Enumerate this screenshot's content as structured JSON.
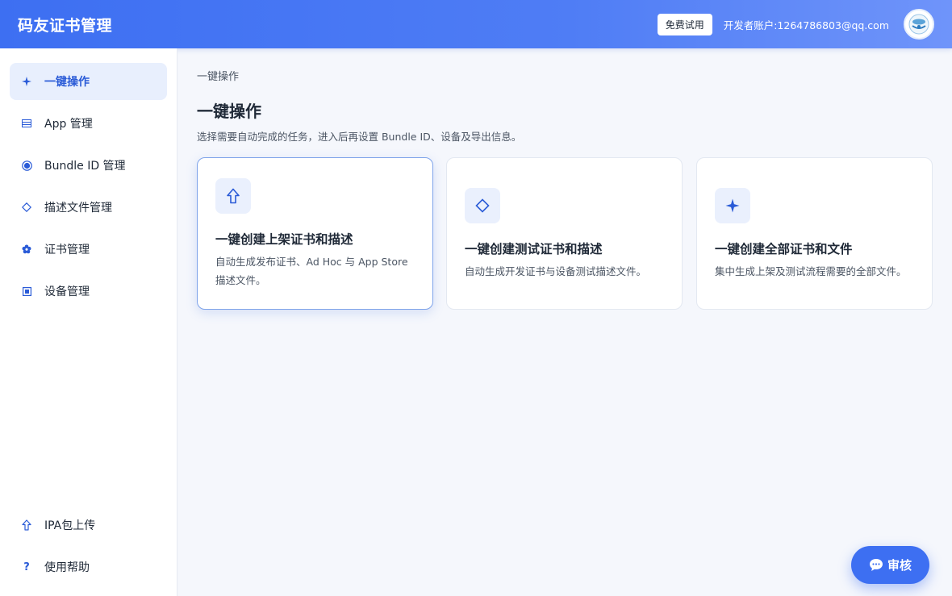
{
  "header": {
    "brand": "码友证书管理",
    "trial_label": "免费试用",
    "account": "开发者账户:1264786803@qq.com"
  },
  "sidebar": {
    "items": [
      {
        "label": "一键操作",
        "icon": "sparkle-icon",
        "active": true
      },
      {
        "label": "App 管理",
        "icon": "list-icon"
      },
      {
        "label": "Bundle ID 管理",
        "icon": "target-icon"
      },
      {
        "label": "描述文件管理",
        "icon": "diamond-icon"
      },
      {
        "label": "证书管理",
        "icon": "flower-icon"
      },
      {
        "label": "设备管理",
        "icon": "device-icon"
      }
    ],
    "bottom_items": [
      {
        "label": "IPA包上传",
        "icon": "upload-arrow-icon"
      },
      {
        "label": "使用帮助",
        "icon": "question-icon"
      }
    ]
  },
  "main": {
    "breadcrumb": "一键操作",
    "title": "一键操作",
    "description": "选择需要自动完成的任务，进入后再设置 Bundle ID、设备及导出信息。",
    "cards": [
      {
        "title": "一键创建上架证书和描述",
        "description": "自动生成发布证书、Ad Hoc 与 App Store 描述文件。",
        "icon": "upload-arrow-icon",
        "selected": true
      },
      {
        "title": "一键创建测试证书和描述",
        "description": "自动生成开发证书与设备测试描述文件。",
        "icon": "diamond-icon"
      },
      {
        "title": "一键创建全部证书和文件",
        "description": "集中生成上架及测试流程需要的全部文件。",
        "icon": "sparkle-icon"
      }
    ]
  },
  "fab": {
    "label": "审核",
    "icon": "chat-bubble-icon"
  },
  "colors": {
    "primary": "#3d6ff2",
    "active_bg": "#e8effd",
    "accent_text": "#2a5bd7"
  }
}
